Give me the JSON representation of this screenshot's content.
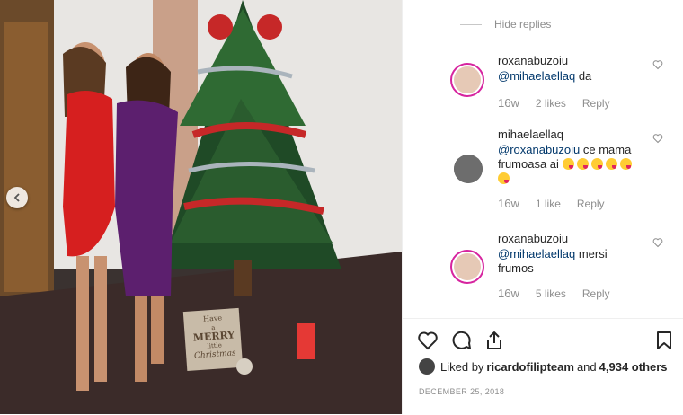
{
  "post": {
    "photo_sign": [
      "Have",
      "a",
      "MERRY",
      "little",
      "Christmas"
    ]
  },
  "thread": {
    "hide_replies": "Hide replies",
    "comments": [
      {
        "username": "roxanabuzoiu",
        "mention": "@mihaelaellaq",
        "text": " da",
        "time": "16w",
        "likes": "2 likes",
        "reply": "Reply",
        "avatar_icon": "user-avatar-story-ring"
      },
      {
        "username": "mihaelaellaq",
        "mention": "@roxanabuzoiu",
        "text": " ce mama frumoasa ai",
        "emoji_count": 6,
        "time": "16w",
        "likes": "1 like",
        "reply": "Reply",
        "avatar_icon": "user-avatar"
      },
      {
        "username": "roxanabuzoiu",
        "mention": "@mihaelaellaq",
        "text": " mersi frumos",
        "time": "16w",
        "likes": "5 likes",
        "reply": "Reply",
        "avatar_icon": "user-avatar-story-ring"
      }
    ]
  },
  "actions": {
    "icons": [
      "heart-icon",
      "comment-icon",
      "share-icon",
      "bookmark-icon"
    ],
    "liked_prefix": "Liked by",
    "liked_user": "ricardofilipteam",
    "liked_and": "and",
    "liked_count": "4,934 others",
    "date": "DECEMBER 25, 2018"
  },
  "colors": {
    "story_ring": "#d6249f",
    "text": "#262626",
    "muted": "#8e8e8e",
    "mention": "#00376b"
  }
}
